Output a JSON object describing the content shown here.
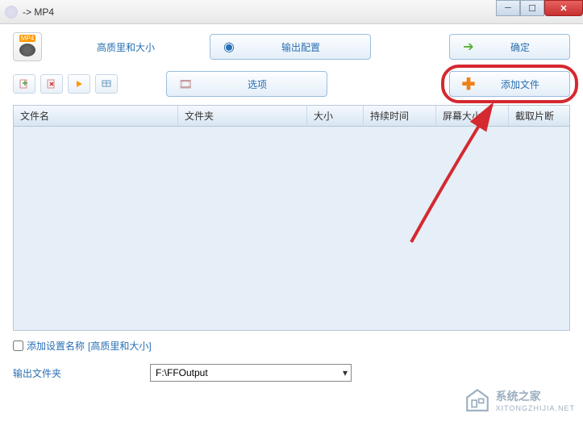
{
  "window": {
    "title": "-> MP4"
  },
  "format": {
    "badge": "MP4",
    "quality_label": "高质里和大小"
  },
  "buttons": {
    "output_config": "输出配置",
    "ok": "确定",
    "options": "选项",
    "add_file": "添加文件"
  },
  "table": {
    "headers": {
      "filename": "文件名",
      "folder": "文件夹",
      "size": "大小",
      "duration": "持续时间",
      "screen_size": "屏幕大小",
      "trim": "截取片断"
    }
  },
  "add_settings": {
    "label": "添加设置名称",
    "value": "[高质里和大小]"
  },
  "output": {
    "label": "输出文件夹",
    "path": "F:\\FFOutput"
  },
  "watermark": {
    "text": "系统之家",
    "url": "XITONGZHIJIA.NET"
  }
}
